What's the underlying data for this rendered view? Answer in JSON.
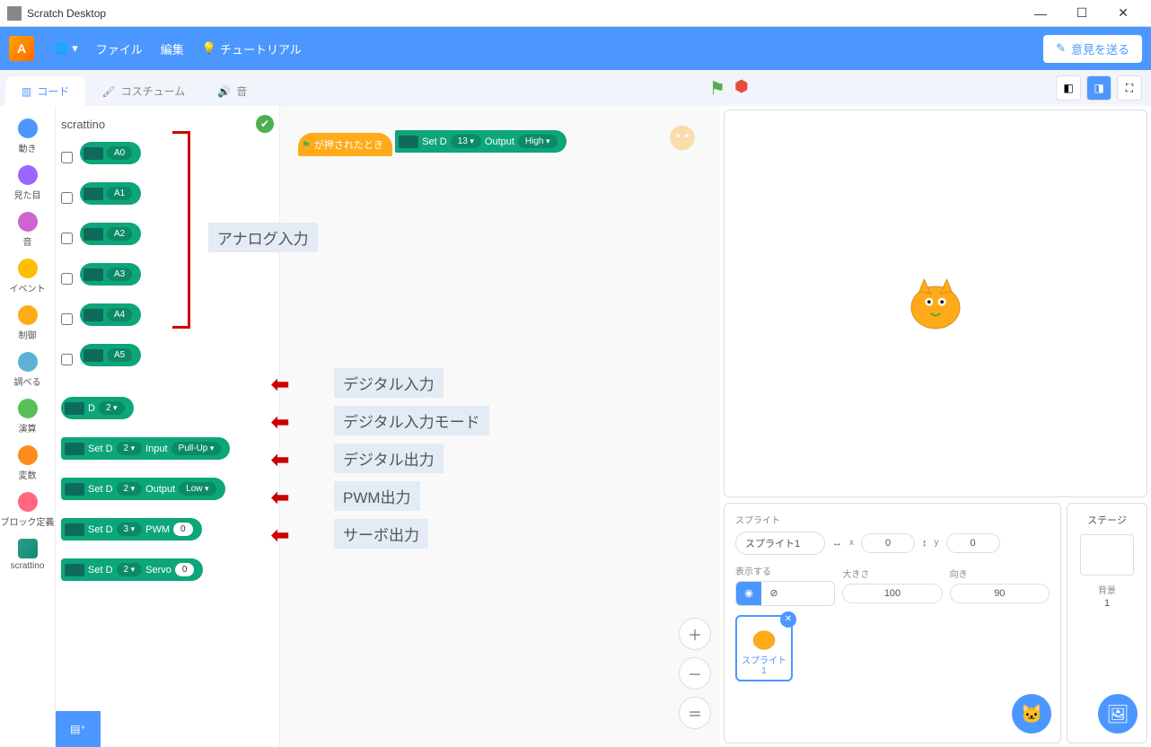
{
  "window": {
    "title": "Scratch Desktop"
  },
  "menubar": {
    "logo_letter": "A",
    "file": "ファイル",
    "edit": "編集",
    "tutorials": "チュートリアル",
    "feedback": "意見を送る"
  },
  "tabs": {
    "code": "コード",
    "costumes": "コスチューム",
    "sounds": "音"
  },
  "categories": [
    {
      "name": "動き",
      "color": "#4C97FF"
    },
    {
      "name": "見た目",
      "color": "#9966FF"
    },
    {
      "name": "音",
      "color": "#CF63CF"
    },
    {
      "name": "イベント",
      "color": "#FFBF00"
    },
    {
      "name": "制御",
      "color": "#FFAB19"
    },
    {
      "name": "調べる",
      "color": "#5CB1D6"
    },
    {
      "name": "演算",
      "color": "#59C059"
    },
    {
      "name": "変数",
      "color": "#FF8C1A"
    },
    {
      "name": "ブロック定義",
      "color": "#FF6680"
    }
  ],
  "extension_cat": "scrattino",
  "palette": {
    "title": "scrattino",
    "analog": [
      "A0",
      "A1",
      "A2",
      "A3",
      "A4",
      "A5"
    ],
    "digital_read": {
      "d": "D",
      "pin": "2"
    },
    "set_input": {
      "cmd": "Set D",
      "pin": "2",
      "mode": "Input",
      "pull": "Pull-Up"
    },
    "set_output": {
      "cmd": "Set D",
      "pin": "2",
      "mode": "Output",
      "val": "Low"
    },
    "set_pwm": {
      "cmd": "Set D",
      "pin": "3",
      "mode": "PWM",
      "val": "0"
    },
    "set_servo": {
      "cmd": "Set D",
      "pin": "2",
      "mode": "Servo",
      "val": "0"
    }
  },
  "script": {
    "hat": "が押されたとき",
    "b1": {
      "cmd": "Set D",
      "pin": "13",
      "mode": "Output",
      "val": "High"
    }
  },
  "annotations": {
    "analog": "アナログ入力",
    "dread": "デジタル入力",
    "dmode": "デジタル入力モード",
    "dout": "デジタル出力",
    "pwm": "PWM出力",
    "servo": "サーボ出力"
  },
  "sprite_panel": {
    "header": "スプライト",
    "name": "スプライト1",
    "x_lbl": "x",
    "x_val": "0",
    "y_lbl": "y",
    "y_val": "0",
    "show_lbl": "表示する",
    "size_lbl": "大きさ",
    "size_val": "100",
    "dir_lbl": "向き",
    "dir_val": "90",
    "thumb": "スプライト1"
  },
  "stage_panel": {
    "header": "ステージ",
    "backdrops_lbl": "背景",
    "backdrops_n": "1"
  }
}
